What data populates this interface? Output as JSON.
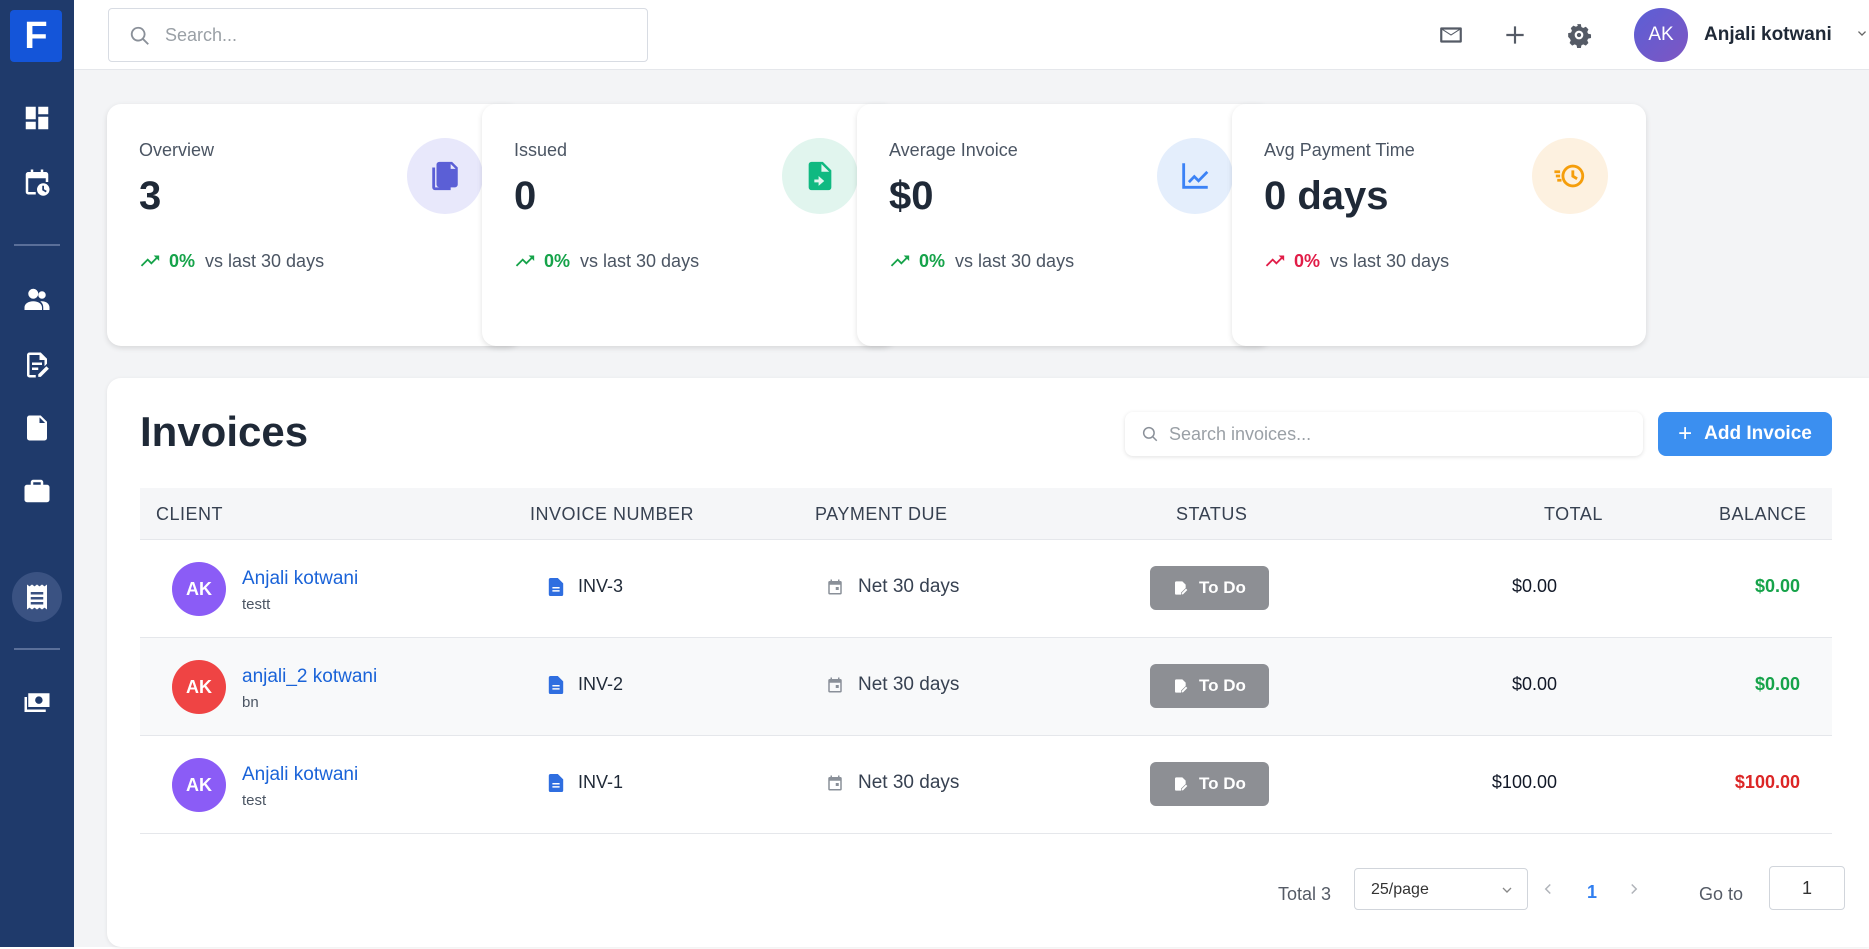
{
  "app": {
    "logo_letter": "F"
  },
  "sidebar": {
    "items": [
      {
        "icon": "dashboard-icon"
      },
      {
        "icon": "calendar-clock-icon"
      },
      {
        "icon": "users-icon"
      },
      {
        "icon": "edit-document-icon"
      },
      {
        "icon": "document-icon"
      },
      {
        "icon": "briefcase-icon"
      },
      {
        "icon": "receipt-icon",
        "active": true
      },
      {
        "icon": "money-icon"
      }
    ]
  },
  "topbar": {
    "search_placeholder": "Search...",
    "icons": [
      "mail-icon",
      "plus-icon",
      "settings-icon"
    ],
    "user": {
      "initials": "AK",
      "name": "Anjali kotwani"
    }
  },
  "stats": [
    {
      "label": "Overview",
      "value": "3",
      "pct": "0%",
      "compare": "vs last 30 days",
      "trend_color": "#16a34a",
      "icon": "documents-icon",
      "icon_bg": "#e8e8fb",
      "icon_color": "#5b5fd6"
    },
    {
      "label": "Issued",
      "value": "0",
      "pct": "0%",
      "compare": "vs last 30 days",
      "trend_color": "#16a34a",
      "icon": "file-export-icon",
      "icon_bg": "#e1f5ee",
      "icon_color": "#10b981"
    },
    {
      "label": "Average Invoice",
      "value": "$0",
      "pct": "0%",
      "compare": "vs last 30 days",
      "trend_color": "#16a34a",
      "icon": "line-chart-icon",
      "icon_bg": "#e4eefc",
      "icon_color": "#3b82f6"
    },
    {
      "label": "Avg Payment Time",
      "value": "0 days",
      "pct": "0%",
      "compare": "vs last 30 days",
      "trend_color": "#e11d48",
      "icon": "fast-clock-icon",
      "icon_bg": "#fdf1e0",
      "icon_color": "#f59e0b"
    }
  ],
  "invoices": {
    "title": "Invoices",
    "search_placeholder": "Search invoices...",
    "add_label": "Add Invoice",
    "columns": [
      "CLIENT",
      "INVOICE NUMBER",
      "PAYMENT DUE",
      "STATUS",
      "TOTAL",
      "BALANCE"
    ],
    "rows": [
      {
        "initials": "AK",
        "avatar_color": "#8b5cf6",
        "client": "Anjali kotwani",
        "sub": "testt",
        "number": "INV-3",
        "due": "Net 30 days",
        "status": "To Do",
        "total": "$0.00",
        "balance": "$0.00",
        "balance_color": "#16a34a"
      },
      {
        "initials": "AK",
        "avatar_color": "#ef4444",
        "client": "anjali_2 kotwani",
        "sub": "bn",
        "number": "INV-2",
        "due": "Net 30 days",
        "status": "To Do",
        "total": "$0.00",
        "balance": "$0.00",
        "balance_color": "#16a34a"
      },
      {
        "initials": "AK",
        "avatar_color": "#8b5cf6",
        "client": "Anjali kotwani",
        "sub": "test",
        "number": "INV-1",
        "due": "Net 30 days",
        "status": "To Do",
        "total": "$100.00",
        "balance": "$100.00",
        "balance_color": "#dc2626"
      }
    ],
    "pagination": {
      "total_text": "Total 3",
      "page_size": "25/page",
      "current_page": "1",
      "goto_label": "Go to",
      "goto_value": "1"
    }
  }
}
